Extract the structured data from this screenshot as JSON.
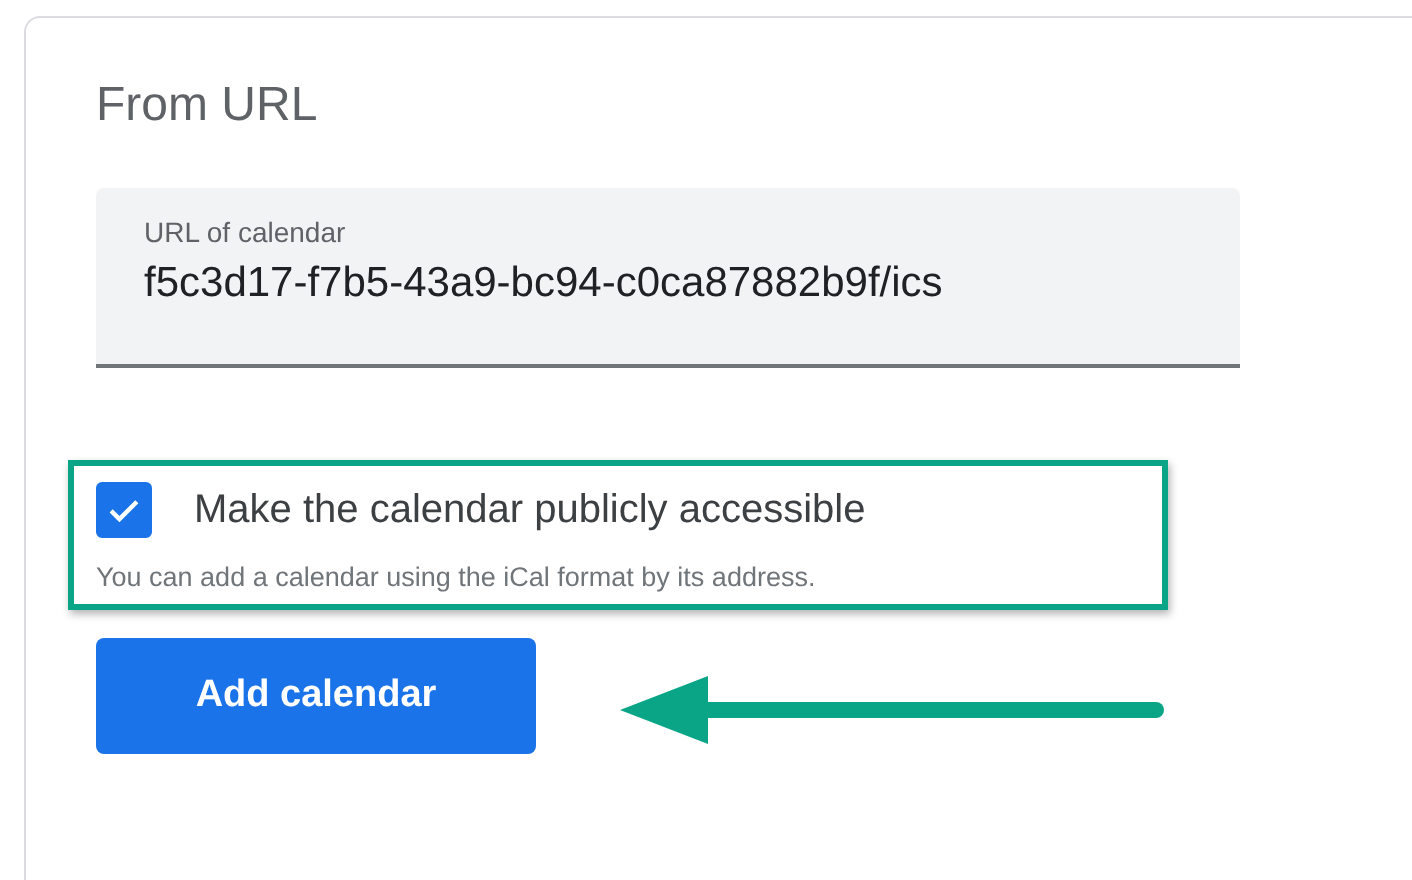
{
  "section": {
    "title": "From URL"
  },
  "url_field": {
    "label": "URL of calendar",
    "value": "f5c3d17-f7b5-43a9-bc94-c0ca87882b9f/ics"
  },
  "public_option": {
    "label": "Make the calendar publicly accessible",
    "checked": true
  },
  "hint": "You can add a calendar using the iCal format by its address.",
  "button": "Add calendar"
}
